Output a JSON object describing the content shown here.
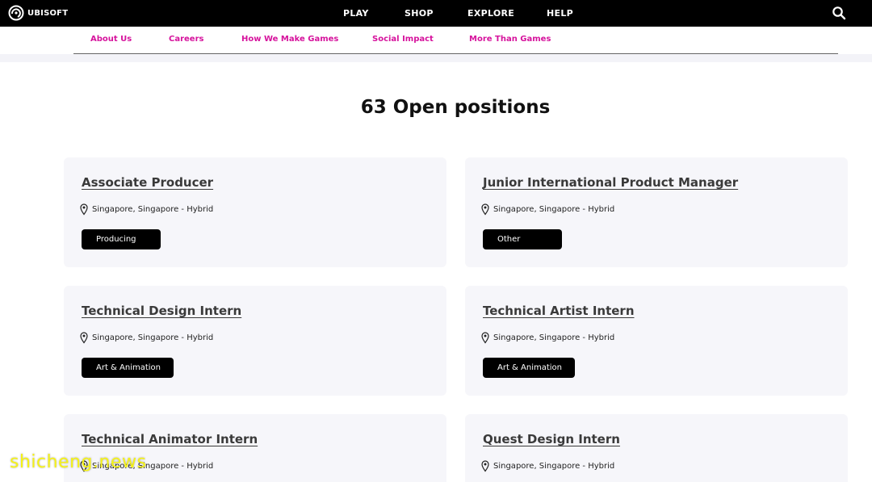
{
  "brand": {
    "name": "UBISOFT"
  },
  "topnav": {
    "items": [
      {
        "label": "PLAY"
      },
      {
        "label": "SHOP"
      },
      {
        "label": "EXPLORE"
      },
      {
        "label": "HELP"
      }
    ]
  },
  "subnav": {
    "items": [
      {
        "label": "About Us"
      },
      {
        "label": "Careers"
      },
      {
        "label": "How We Make Games"
      },
      {
        "label": "Social Impact"
      },
      {
        "label": "More Than Games"
      }
    ],
    "color": "#d6129c"
  },
  "heading": "63 Open positions",
  "jobs": [
    {
      "title": "Associate Producer",
      "location": "Singapore, Singapore - Hybrid",
      "tag": "Producing"
    },
    {
      "title": "Junior International Product Manager",
      "location": "Singapore, Singapore - Hybrid",
      "tag": "Other"
    },
    {
      "title": "Technical Design Intern",
      "location": "Singapore, Singapore - Hybrid",
      "tag": "Art & Animation"
    },
    {
      "title": "Technical Artist Intern",
      "location": "Singapore, Singapore - Hybrid",
      "tag": "Art & Animation"
    },
    {
      "title": "Technical Animator Intern",
      "location": "Singapore, Singapore - Hybrid"
    },
    {
      "title": "Quest Design Intern",
      "location": "Singapore, Singapore - Hybrid"
    }
  ],
  "watermark": "shicheng.news",
  "icons": {
    "logo": "ubisoft-swirl-icon",
    "search": "search-icon",
    "location": "location-pin-icon"
  }
}
